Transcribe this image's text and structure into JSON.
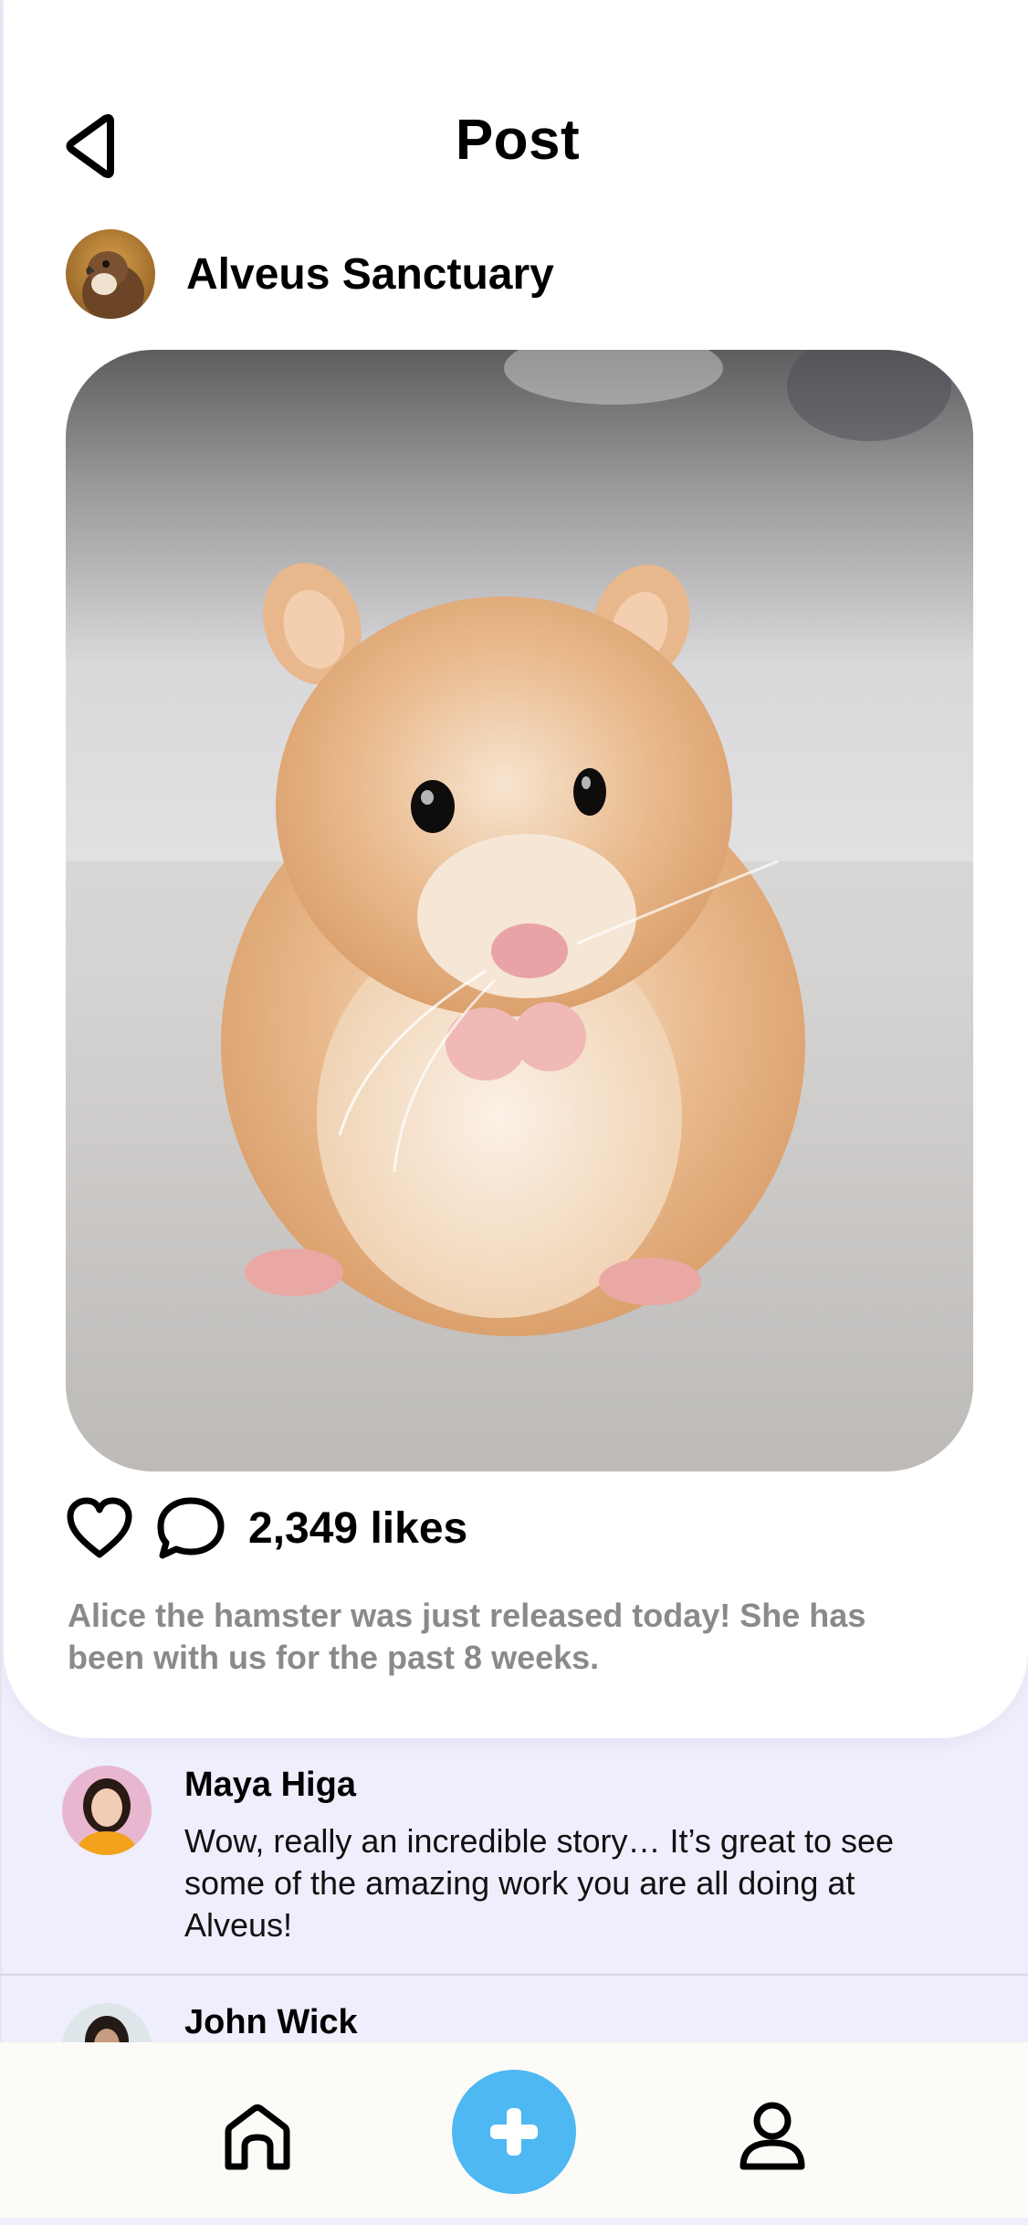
{
  "header": {
    "title": "Post",
    "back_icon": "back-triangle-icon"
  },
  "post": {
    "author": {
      "name": "Alveus Sanctuary",
      "avatar": "hawk-avatar"
    },
    "image": "hamster-photo",
    "actions": {
      "like_icon": "heart-icon",
      "comment_icon": "comment-bubble-icon"
    },
    "likes_text": "2,349 likes",
    "caption": "Alice the hamster was just released today! She has been with us for the past 8 weeks."
  },
  "comments": [
    {
      "name": "Maya Higa",
      "text": "Wow, really an incredible story… It’s great to see some of the amazing work you are all doing at Alveus!"
    },
    {
      "name": "John Wick",
      "text": ""
    }
  ],
  "tabbar": {
    "items": [
      "home-icon",
      "add-plus-icon",
      "profile-icon"
    ],
    "accent": "#4db8f2"
  },
  "colors": {
    "background": "#efeefc",
    "card": "#ffffff",
    "caption": "#8a8a8a",
    "tabbar": "#fcfbf7"
  }
}
